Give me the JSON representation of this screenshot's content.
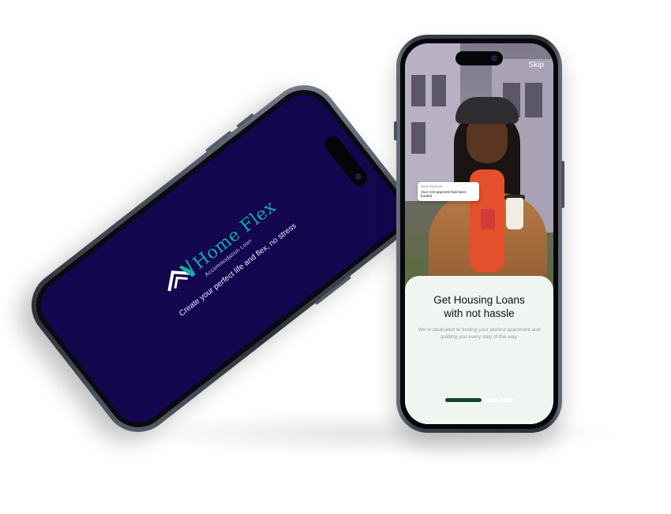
{
  "splash": {
    "brand_name": "Home Flex",
    "brand_sub": "Accommodation Loan",
    "tagline": "Create your perfect life and flex, no stress"
  },
  "onboarding": {
    "skip_label": "Skip",
    "notification": {
      "title": "Rent Payment",
      "body": "Your rent payment has been funded"
    },
    "title_line1": "Get Housing Loans",
    "title_line2": "with not hassle",
    "description": "We're dedicated to finding your perfect apartment and guiding you every step of the way.",
    "pager": {
      "active_index": 0,
      "total": 3
    }
  },
  "colors": {
    "splash_bg": "#14064f",
    "brand_teal": "#1aa9a0",
    "pager_active": "#0f4a2f",
    "sheet_bg": "#f0f5f2"
  }
}
